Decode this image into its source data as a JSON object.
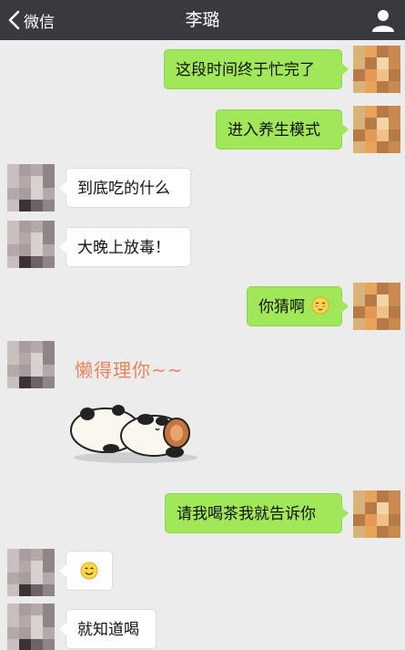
{
  "navbar": {
    "back_label": "微信",
    "title": "李璐"
  },
  "messages": [
    {
      "from": "me",
      "text": "这段时间终于忙完了"
    },
    {
      "from": "me",
      "text": "进入养生模式"
    },
    {
      "from": "them",
      "text": "到底吃的什么"
    },
    {
      "from": "them",
      "text": "大晚上放毒！"
    },
    {
      "from": "me",
      "text": "你猜啊",
      "emoji": "shy-emoji"
    },
    {
      "from": "them",
      "sticker": "panda-sticker",
      "sticker_text": "懒得理你~~"
    },
    {
      "from": "me",
      "text": "请我喝茶我就告诉你"
    },
    {
      "from": "them",
      "emoji": "smile-emoji"
    },
    {
      "from": "them",
      "text": "就知道喝"
    }
  ],
  "colors": {
    "navbar": "#393a3f",
    "background": "#ececec",
    "my_bubble": "#a0e75a",
    "their_bubble": "#ffffff"
  }
}
